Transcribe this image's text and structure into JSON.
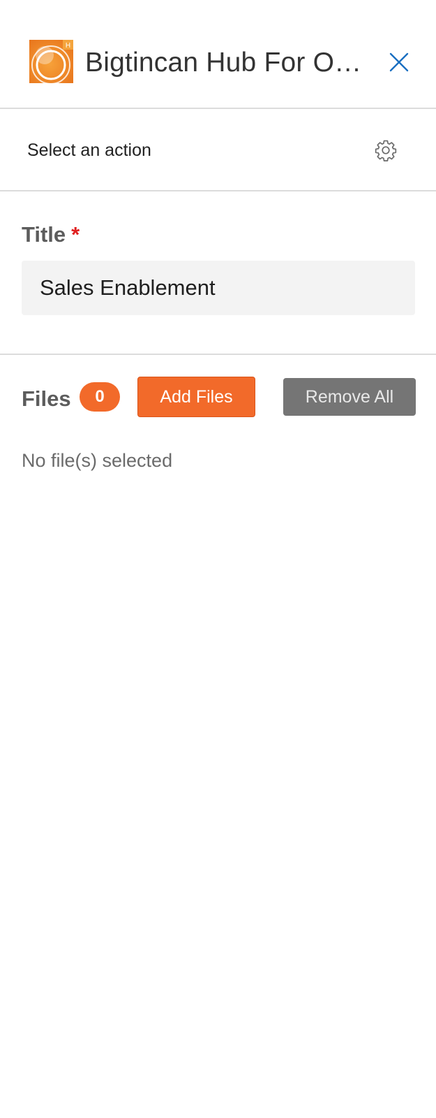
{
  "header": {
    "app_title": "Bigtincan Hub For Out...",
    "logo_badge": "H",
    "close_icon": "close-icon"
  },
  "action_bar": {
    "label": "Select an action",
    "settings_icon": "gear-icon"
  },
  "title_field": {
    "label": "Title",
    "required_mark": "*",
    "value": "Sales Enablement"
  },
  "files": {
    "label": "Files",
    "count": "0",
    "add_button": "Add Files",
    "remove_button": "Remove All",
    "empty_message": "No file(s) selected"
  },
  "colors": {
    "accent": "#f26a2a",
    "close_icon": "#1a6fc1",
    "remove_button": "#757575",
    "required": "#e02020"
  }
}
